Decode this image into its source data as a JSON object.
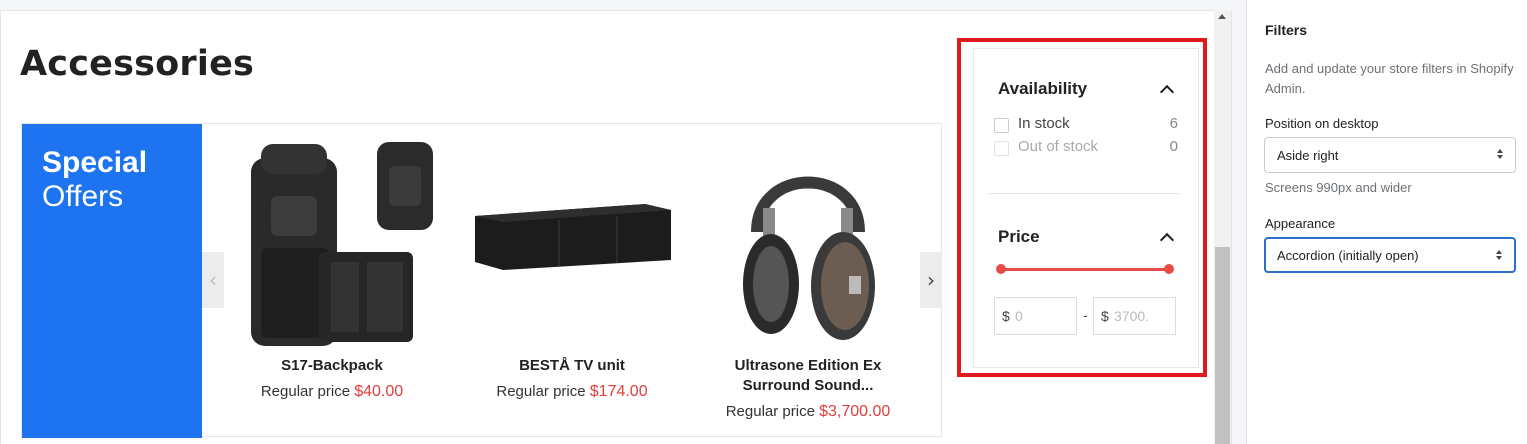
{
  "collection": {
    "title": "Accessories"
  },
  "promo": {
    "line1": "Special",
    "line2": "Offers"
  },
  "carousel": {
    "prev_icon": "chevron-left-icon",
    "next_icon": "chevron-right-icon",
    "products": [
      {
        "name": "S17-Backpack",
        "price_label": "Regular price",
        "price": "$40.00"
      },
      {
        "name": "BESTÅ TV unit",
        "price_label": "Regular price",
        "price": "$174.00"
      },
      {
        "name_line1": "Ultrasone Edition Ex",
        "name_line2": "Surround Sound...",
        "price_label": "Regular price",
        "price": "$3,700.00"
      }
    ]
  },
  "filters": {
    "availability": {
      "title": "Availability",
      "options": [
        {
          "label": "In stock",
          "count": "6"
        },
        {
          "label": "Out of stock",
          "count": "0"
        }
      ]
    },
    "price": {
      "title": "Price",
      "currency": "$",
      "min_placeholder": "0",
      "max_placeholder": "3700.",
      "separator": "-",
      "slider_min_fraction": 0,
      "slider_max_fraction": 1
    }
  },
  "editor": {
    "title": "Filters",
    "help": "Add and update your store filters in Shopify Admin.",
    "position_label": "Position on desktop",
    "position_value": "Aside right",
    "position_hint": "Screens 990px and wider",
    "appearance_label": "Appearance",
    "appearance_value": "Accordion (initially open)"
  },
  "colors": {
    "promo_bg": "#1e74f0",
    "sale_price": "#e03e3e",
    "highlight_border": "#e0191f",
    "slider": "#e84b47",
    "focus": "#2c6ecb"
  }
}
